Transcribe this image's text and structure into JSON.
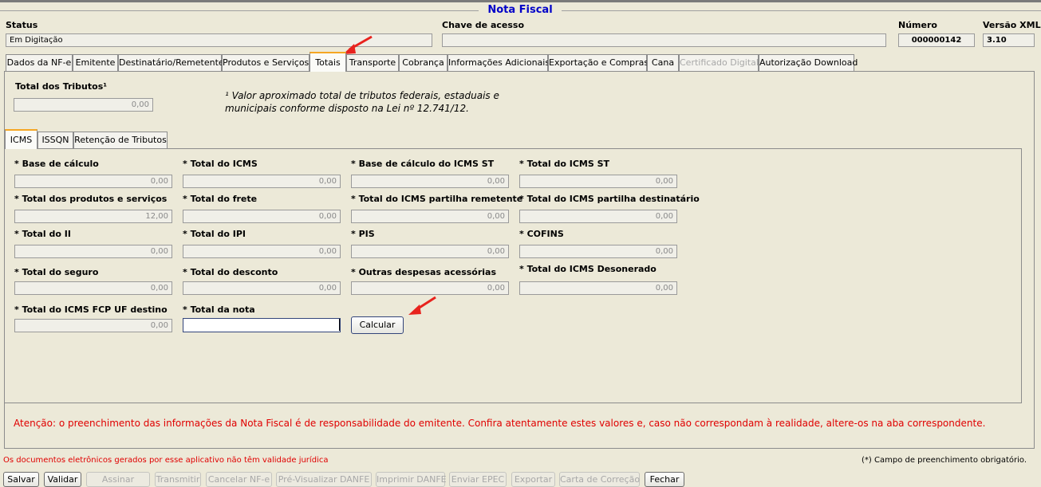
{
  "window": {
    "title": "Nota Fiscal"
  },
  "header": {
    "status_label": "Status",
    "status_value": "Em Digitação",
    "chave_label": "Chave de acesso",
    "chave_value": "",
    "numero_label": "Número",
    "numero_value": "000000142",
    "versao_label": "Versão XML",
    "versao_value": "3.10"
  },
  "tabs": [
    {
      "label": "Dados da NF-e"
    },
    {
      "label": "Emitente"
    },
    {
      "label": "Destinatário/Remetente"
    },
    {
      "label": "Produtos e Serviços"
    },
    {
      "label": "Totais",
      "active": true
    },
    {
      "label": "Transporte"
    },
    {
      "label": "Cobrança"
    },
    {
      "label": "Informações Adicionais"
    },
    {
      "label": "Exportação e Compras"
    },
    {
      "label": "Cana"
    },
    {
      "label": "Certificado Digital",
      "disabled": true
    },
    {
      "label": "Autorização Download"
    }
  ],
  "tributos": {
    "label": "Total dos Tributos¹",
    "value": "0,00",
    "note_line1": "¹ Valor aproximado total de tributos federais, estaduais e",
    "note_line2": "municipais conforme disposto na Lei nº 12.741/12."
  },
  "subtabs": [
    {
      "label": "ICMS",
      "active": true
    },
    {
      "label": "ISSQN"
    },
    {
      "label": "Retenção de Tributos"
    }
  ],
  "fields": {
    "base_calculo": {
      "label": "* Base de cálculo",
      "value": "0,00"
    },
    "total_icms": {
      "label": "* Total do ICMS",
      "value": "0,00"
    },
    "base_calculo_st": {
      "label": "* Base de cálculo do ICMS ST",
      "value": "0,00"
    },
    "total_icms_st": {
      "label": "* Total do ICMS ST",
      "value": "0,00"
    },
    "total_produtos": {
      "label": "* Total dos produtos e serviços",
      "value": "12,00"
    },
    "total_frete": {
      "label": "* Total do frete",
      "value": "0,00"
    },
    "partilha_remetente": {
      "label": "* Total do ICMS partilha remetente",
      "value": "0,00"
    },
    "partilha_destinatario": {
      "label": "* Total do ICMS partilha destinatário",
      "value": "0,00"
    },
    "total_ii": {
      "label": "* Total do II",
      "value": "0,00"
    },
    "total_ipi": {
      "label": "* Total do IPI",
      "value": "0,00"
    },
    "pis": {
      "label": "* PIS",
      "value": "0,00"
    },
    "cofins": {
      "label": "* COFINS",
      "value": "0,00"
    },
    "total_seguro": {
      "label": "* Total do seguro",
      "value": "0,00"
    },
    "total_desconto": {
      "label": "* Total do desconto",
      "value": "0,00"
    },
    "outras_despesas": {
      "label": "* Outras despesas acessórias",
      "value": "0,00"
    },
    "icms_desonerado": {
      "label": "* Total do ICMS Desonerado",
      "value": "0,00"
    },
    "fcp_uf_destino": {
      "label": "* Total do ICMS FCP UF destino",
      "value": "0,00"
    },
    "total_nota": {
      "label": "* Total da nota",
      "value": ""
    }
  },
  "calcular_label": "Calcular",
  "warning": "Atenção: o preenchimento das informações da Nota Fiscal é de responsabilidade do emitente. Confira atentamente estes valores e, caso não correspondam à realidade, altere-os na aba correspondente.",
  "footer": {
    "disclaimer": "Os documentos eletrônicos gerados por esse aplicativo não têm validade jurídica",
    "required_note": "(*) Campo de preenchimento obrigatório."
  },
  "buttons": [
    {
      "label": "Salvar"
    },
    {
      "label": "Validar"
    },
    {
      "label": "Assinar",
      "disabled": true
    },
    {
      "label": "Transmitir",
      "disabled": true
    },
    {
      "label": "Cancelar NF-e",
      "disabled": true
    },
    {
      "label": "Pré-Visualizar DANFE",
      "disabled": true
    },
    {
      "label": "Imprimir DANFE",
      "disabled": true
    },
    {
      "label": "Enviar EPEC",
      "disabled": true
    },
    {
      "label": "Exportar",
      "disabled": true
    },
    {
      "label": "Carta de Correção",
      "disabled": true
    },
    {
      "label": "Fechar"
    }
  ],
  "colors": {
    "title": "#0000c8",
    "warning": "#e00000",
    "active_tab_accent": "#f5a623",
    "arrow": "#e8231e"
  },
  "icons": [
    "red-arrow-icon"
  ]
}
